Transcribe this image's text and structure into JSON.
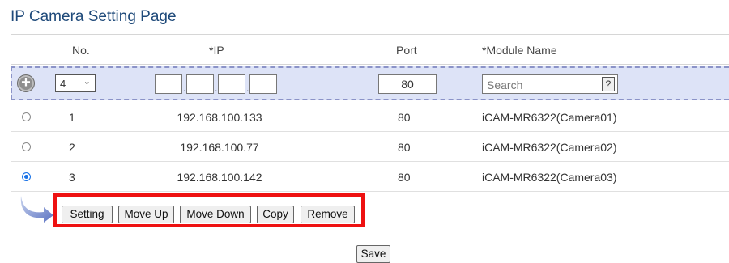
{
  "page": {
    "title": "IP Camera Setting Page"
  },
  "table": {
    "headers": {
      "no": "No.",
      "ip": "*IP",
      "port": "Port",
      "module": "*Module Name"
    },
    "add_row": {
      "add_icon": "plus-circle-icon",
      "no_selected": "4",
      "ip_octets": [
        "",
        "",
        "",
        ""
      ],
      "port_value": "80",
      "module_placeholder": "Search",
      "help_label": "?"
    },
    "rows": [
      {
        "no": "1",
        "ip": "192.168.100.133",
        "port": "80",
        "module": "iCAM-MR6322(Camera01)",
        "selected": false
      },
      {
        "no": "2",
        "ip": "192.168.100.77",
        "port": "80",
        "module": "iCAM-MR6322(Camera02)",
        "selected": false
      },
      {
        "no": "3",
        "ip": "192.168.100.142",
        "port": "80",
        "module": "iCAM-MR6322(Camera03)",
        "selected": true
      }
    ]
  },
  "actions": {
    "arrow_icon": "curved-arrow-icon",
    "setting": "Setting",
    "move_up": "Move Up",
    "move_down": "Move Down",
    "copy": "Copy",
    "remove": "Remove",
    "highlight_color": "#ee1111"
  },
  "footer": {
    "save": "Save"
  },
  "colors": {
    "title": "#1f4a7a",
    "add_row_bg": "#dde3f7",
    "radio_checked": "#1a73e8"
  }
}
